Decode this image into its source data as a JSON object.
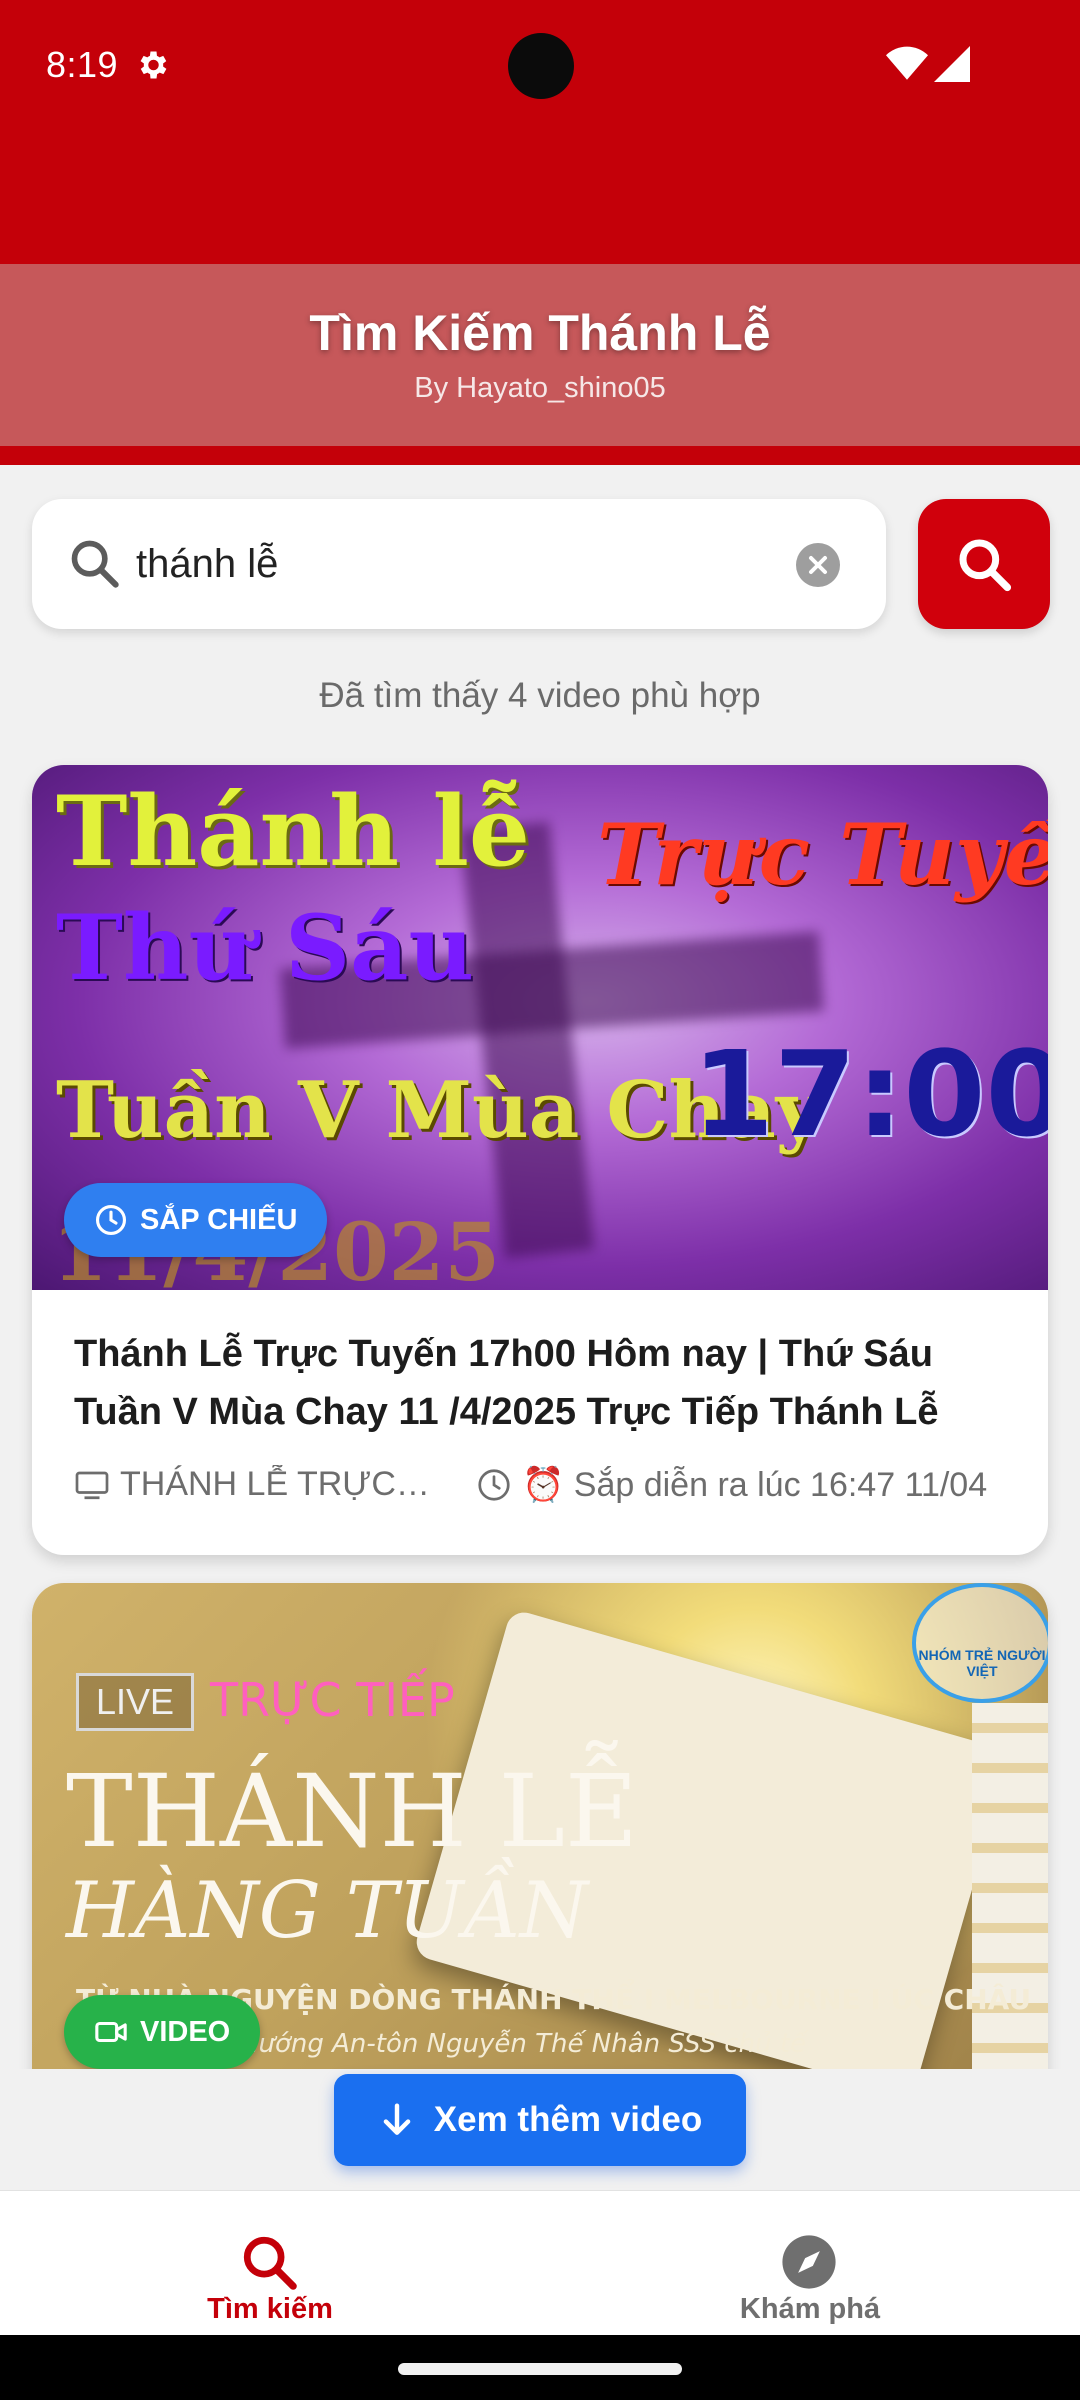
{
  "status_bar": {
    "time": "8:19"
  },
  "header": {
    "title": "Tìm Kiếm Thánh Lễ",
    "subtitle": "By Hayato_shino05"
  },
  "search": {
    "value": "thánh lễ",
    "placeholder": ""
  },
  "results": {
    "summary": "Đã tìm thấy 4 video phù hợp",
    "items": [
      {
        "badge": "SẮP CHIẾU",
        "thumb_lines": [
          "Thánh lễ",
          "Thứ Sáu",
          "Tuần V Mùa Chay",
          "Trực Tuyến",
          "17:00",
          "11/4/2025"
        ],
        "title": "Thánh Lễ Trực Tuyến 17h00 Hôm nay | Thứ Sáu Tuần V Mùa Chay 11 /4/2025 Trực Tiếp Thánh Lễ",
        "channel": "THÁNH LỄ TRỰC …",
        "time": "⏰ Sắp diễn ra lúc 16:47 11/04"
      },
      {
        "badge": "VIDEO",
        "thumb_lines": [
          "LIVE",
          "TRỰC TIẾP",
          "THÁNH LỄ",
          "HÀNG TUẦN",
          "TỪ NHÀ NGUYỆN DÒNG THÁNH THỂ I MELBOURNE I ÚC CHÂU",
          "hướng An-tôn Nguyễn Thế Nhân SSS chủ tế",
          "NHÓM TRẺ NGƯỜI VIỆT"
        ]
      }
    ]
  },
  "load_more": {
    "label": "Xem thêm video"
  },
  "bottom_nav": [
    {
      "label": "Tìm kiếm",
      "icon": "search-icon",
      "active": true
    },
    {
      "label": "Khám phá",
      "icon": "compass-icon",
      "active": false
    }
  ],
  "colors": {
    "primary_red": "#c40009",
    "header_band": "#c6585a",
    "upcoming_badge": "#2f7ff0",
    "video_badge": "#27b24a",
    "load_more": "#1a6ff0"
  }
}
